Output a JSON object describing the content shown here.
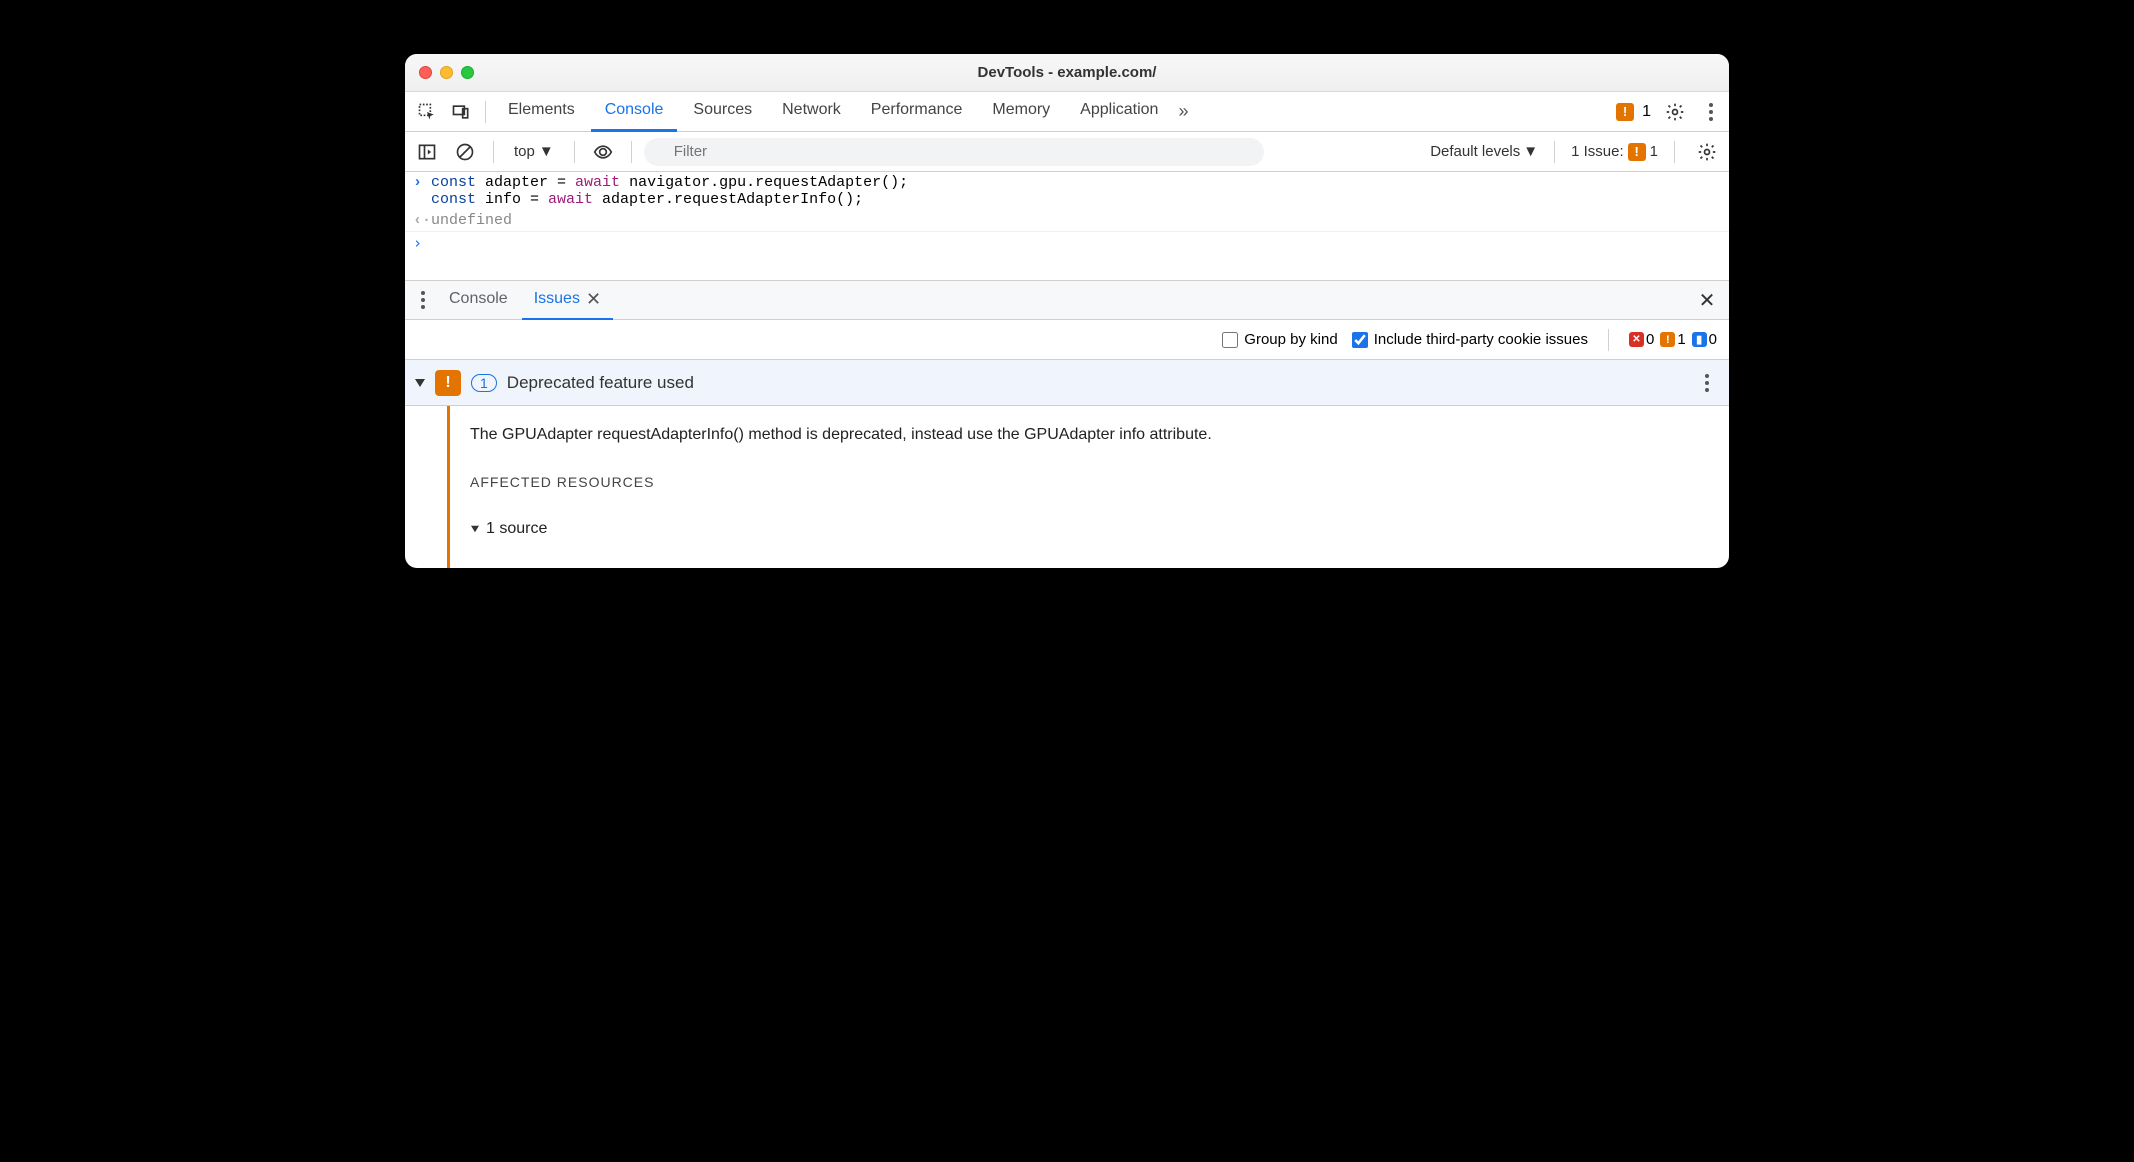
{
  "window": {
    "title": "DevTools - example.com/"
  },
  "tabs": {
    "items": [
      "Elements",
      "Console",
      "Sources",
      "Network",
      "Performance",
      "Memory",
      "Application"
    ],
    "active": "Console",
    "warn_count": "1"
  },
  "context": {
    "label": "top"
  },
  "filter": {
    "placeholder": "Filter"
  },
  "levels": {
    "label": "Default levels"
  },
  "issues_link": {
    "label": "1 Issue:",
    "count": "1"
  },
  "console": {
    "line1": "const adapter = await navigator.gpu.requestAdapter();",
    "line2": "const info = await adapter.requestAdapterInfo();",
    "result": "undefined"
  },
  "drawer": {
    "tabs": [
      "Console",
      "Issues"
    ],
    "active": "Issues"
  },
  "issues_filter": {
    "group_label": "Group by kind",
    "thirdparty_label": "Include third-party cookie issues",
    "counts": {
      "error": "0",
      "warning": "1",
      "info": "0"
    }
  },
  "issue": {
    "count": "1",
    "title": "Deprecated feature used",
    "description": "The GPUAdapter requestAdapterInfo() method is deprecated, instead use the GPUAdapter info attribute.",
    "section": "AFFECTED RESOURCES",
    "source_line": "1 source"
  }
}
